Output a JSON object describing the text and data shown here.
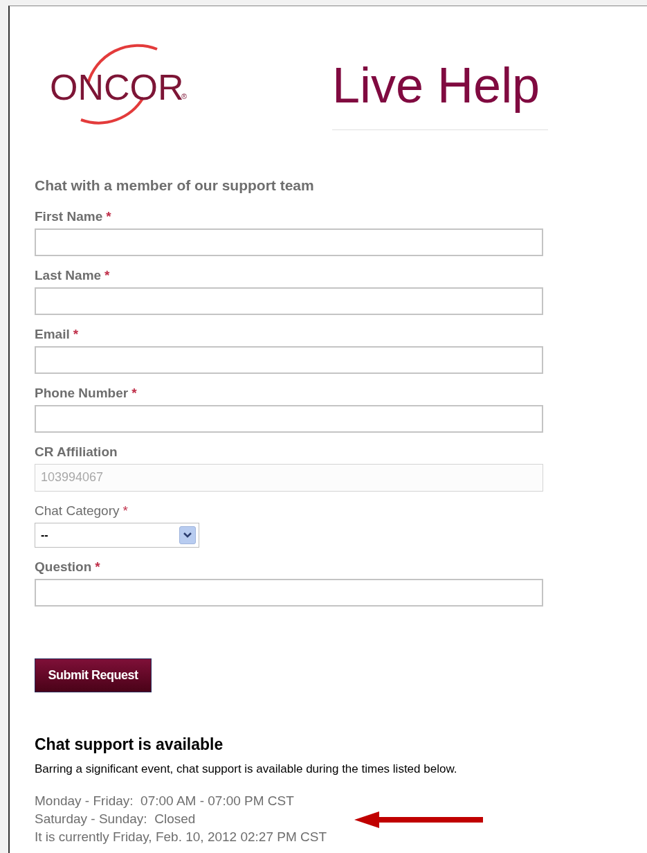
{
  "logo": {
    "text": "ONCOR",
    "mark": "®"
  },
  "title": "Live Help",
  "form": {
    "heading": "Chat with a member of our support team",
    "fields": [
      {
        "kind": "text",
        "label": "First Name",
        "required_mark": "*",
        "disabled": false
      },
      {
        "kind": "text",
        "label": "Last Name",
        "required_mark": "*",
        "disabled": false
      },
      {
        "kind": "text",
        "label": "Email",
        "required_mark": "*",
        "disabled": false
      },
      {
        "kind": "text",
        "label": "Phone Number",
        "required_mark": "*",
        "disabled": false
      },
      {
        "kind": "text",
        "label": "CR Affiliation",
        "value": "103994067",
        "disabled": true
      },
      {
        "kind": "select",
        "label": "Chat Category",
        "required_mark": "*",
        "value": "--",
        "disabled": false
      },
      {
        "kind": "text",
        "label": "Question",
        "required_mark": "*",
        "disabled": false
      }
    ],
    "submit": "Submit Request"
  },
  "availability": {
    "heading": "Chat support is available",
    "note": "Barring a significant event, chat support is available during the times listed below.",
    "lines": [
      "Monday - Friday:  07:00 AM - 07:00 PM CST",
      "Saturday - Sunday:  Closed",
      "It is currently Friday, Feb. 10, 2012 02:27 PM CST"
    ]
  }
}
